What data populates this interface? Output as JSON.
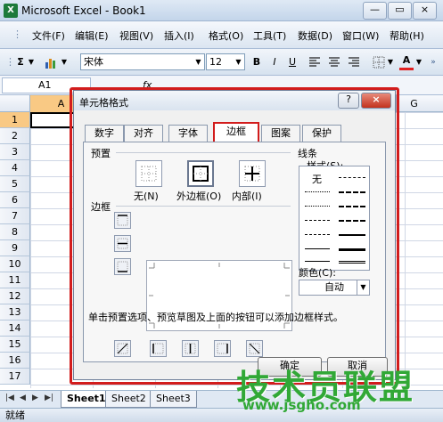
{
  "window": {
    "title": "Microsoft Excel - Book1",
    "logo": "X",
    "min": "—",
    "max": "▭",
    "close": "×"
  },
  "menu": {
    "items": [
      "文件(F)",
      "编辑(E)",
      "视图(V)",
      "插入(I)",
      "格式(O)",
      "工具(T)",
      "数据(D)",
      "窗口(W)",
      "帮助(H)"
    ]
  },
  "toolbar": {
    "autosum": "Σ",
    "font": "宋体",
    "size": "12",
    "bold": "B",
    "italic": "I",
    "underline": "U",
    "font_color_label": "A"
  },
  "formula": {
    "namebox": "A1",
    "fx": "fx"
  },
  "grid": {
    "col_a": "A",
    "col_g": "G",
    "rows": [
      "1",
      "2",
      "3",
      "4",
      "5",
      "6",
      "7",
      "8",
      "9",
      "10",
      "11",
      "12",
      "13",
      "14",
      "15",
      "16",
      "17"
    ]
  },
  "sheets": {
    "tabs": [
      "Sheet1",
      "Sheet2",
      "Sheet3"
    ]
  },
  "status": {
    "text": "就绪"
  },
  "dialog": {
    "title": "单元格格式",
    "help": "?",
    "close": "×",
    "tabs": [
      "数字",
      "对齐",
      "字体",
      "边框",
      "图案",
      "保护"
    ],
    "active_tab": "边框",
    "preset_label": "预置",
    "presets": [
      "无(N)",
      "外边框(O)",
      "内部(I)"
    ],
    "border_label": "边框",
    "line_label": "线条",
    "style_label": "样式(S):",
    "none_style": "无",
    "color_label": "颜色(C):",
    "color_value": "自动",
    "hint": "单击预置选项、预览草图及上面的按钮可以添加边框样式。",
    "ok": "确定",
    "cancel": "取消"
  },
  "watermark": {
    "brand": "技术员联盟",
    "url": "www.jsgho.com"
  }
}
